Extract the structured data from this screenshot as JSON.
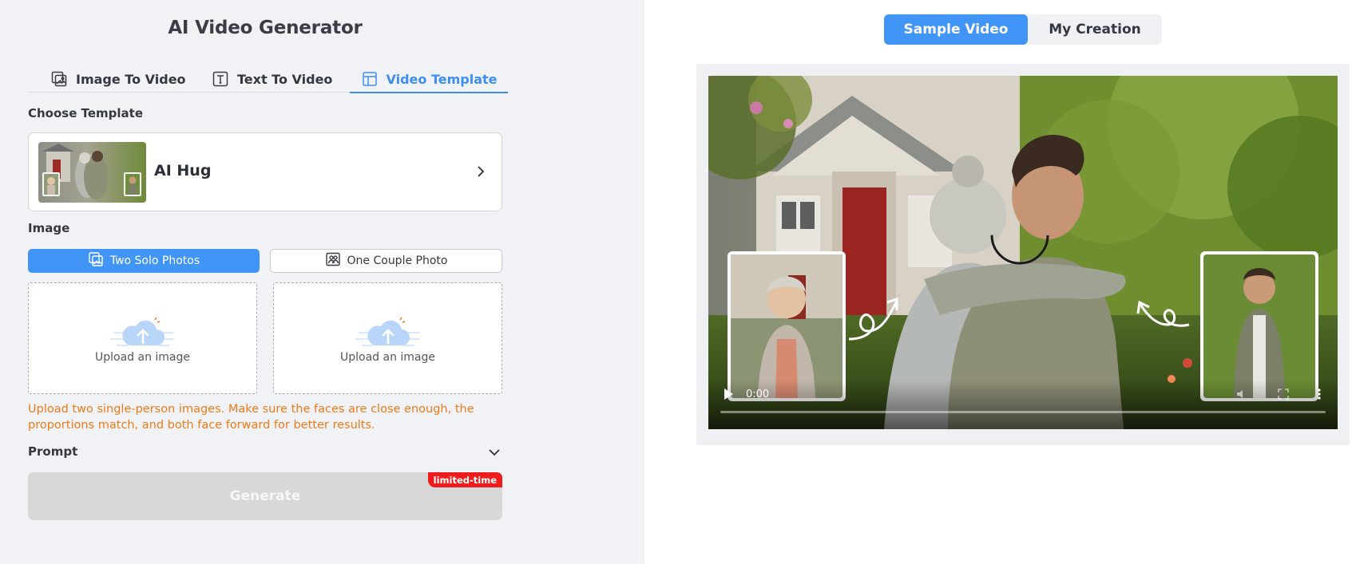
{
  "header": {
    "title": "AI Video Generator"
  },
  "tabs": [
    {
      "label": "Image To Video",
      "icon": "image-to-video-icon"
    },
    {
      "label": "Text To Video",
      "icon": "text-icon"
    },
    {
      "label": "Video Template",
      "icon": "template-icon",
      "active": true
    }
  ],
  "template": {
    "section_label": "Choose Template",
    "name": "AI Hug"
  },
  "image": {
    "section_label": "Image",
    "modes": [
      {
        "label": "Two Solo Photos",
        "active": true
      },
      {
        "label": "One Couple Photo",
        "active": false
      }
    ],
    "uploads": [
      {
        "label": "Upload an image"
      },
      {
        "label": "Upload an image"
      }
    ],
    "hint": "Upload two single-person images. Make sure the faces are close enough, the proportions match, and both face forward for better results."
  },
  "prompt": {
    "label": "Prompt"
  },
  "generate": {
    "label": "Generate",
    "badge": "limited-time"
  },
  "preview": {
    "toggle": [
      {
        "label": "Sample Video",
        "active": true
      },
      {
        "label": "My Creation",
        "active": false
      }
    ],
    "video": {
      "time": "0:00",
      "progress": 0
    }
  },
  "colors": {
    "accent": "#4095f7",
    "warning": "#f07b17",
    "badge": "#ee1c1c",
    "panel_bg": "#f1f2f5"
  }
}
